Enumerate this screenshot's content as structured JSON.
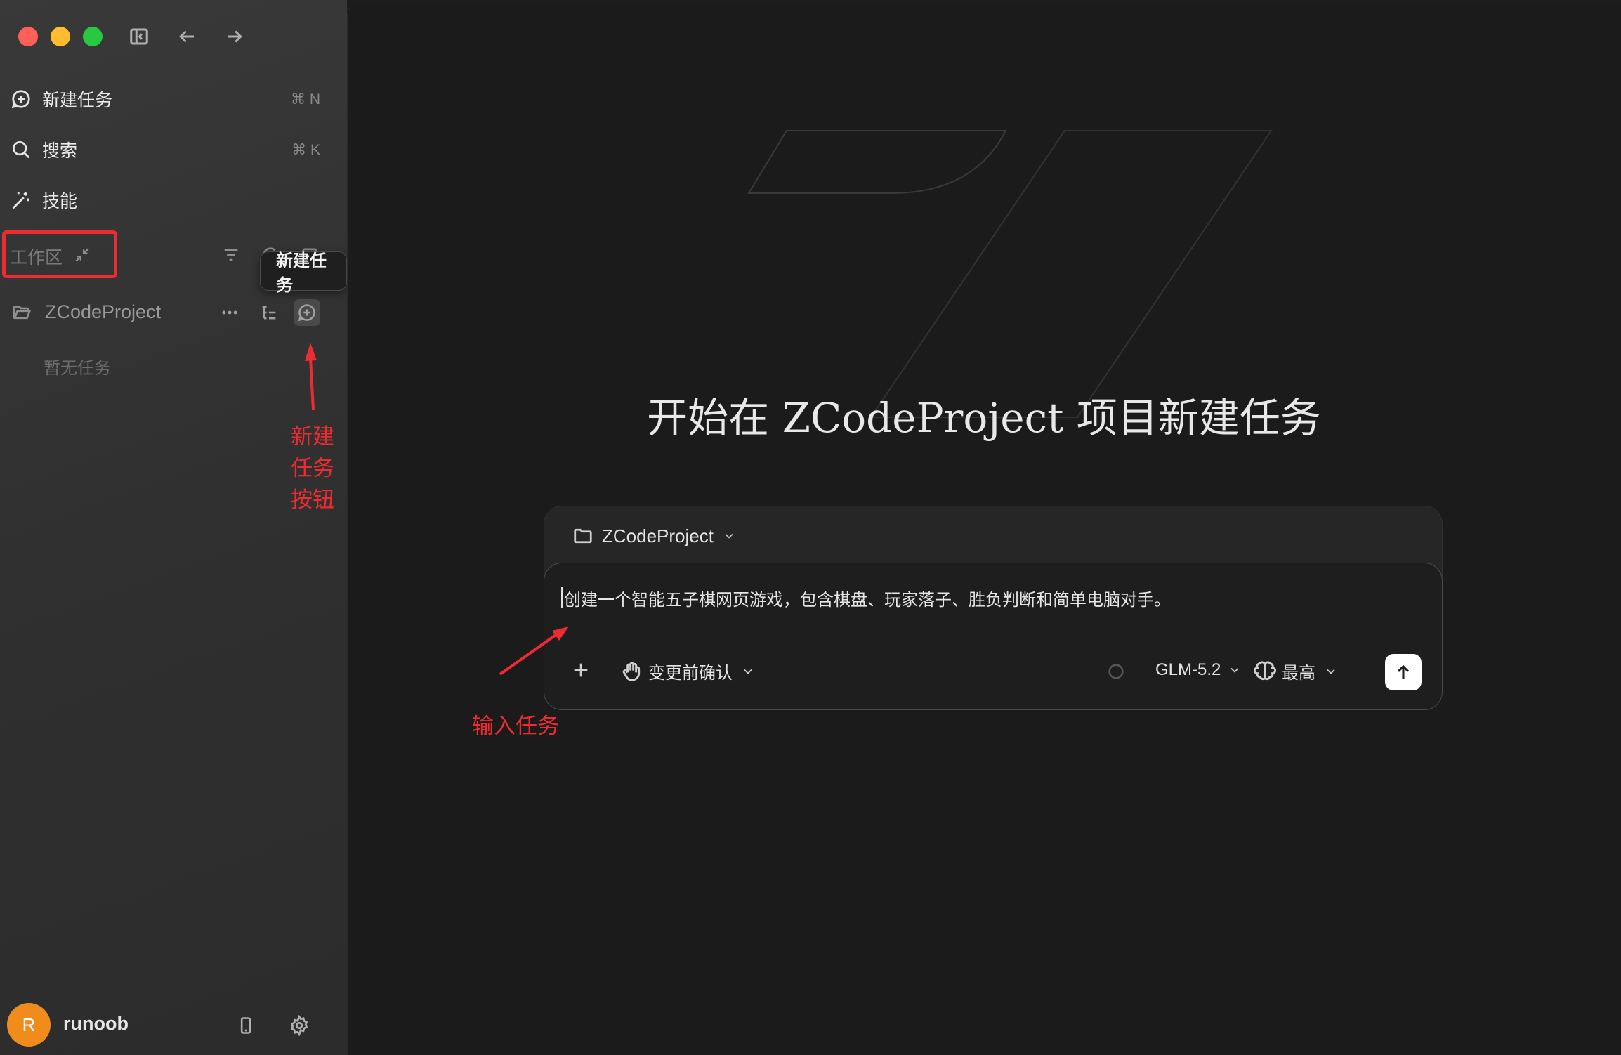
{
  "colors": {
    "annotation_red": "#ed2b32",
    "avatar_orange": "#f08b1c",
    "traffic_close": "#fe5f57",
    "traffic_min": "#febc2e",
    "traffic_max": "#28c840"
  },
  "sidebar": {
    "nav": [
      {
        "label": "新建任务",
        "shortcut": "⌘ N",
        "icon": "new-task-icon"
      },
      {
        "label": "搜索",
        "shortcut": "⌘ K",
        "icon": "search-icon"
      },
      {
        "label": "技能",
        "shortcut": "",
        "icon": "magic-wand-icon"
      }
    ],
    "workspace": {
      "label": "工作区"
    },
    "tooltip": "新建任务",
    "project": {
      "name": "ZCodeProject",
      "empty": "暂无任务"
    },
    "annotation_new_task_button": "新建任务按钮",
    "user": {
      "avatar_letter": "R",
      "name": "runoob"
    }
  },
  "main": {
    "headline": "开始在 ZCodeProject 项目新建任务",
    "composer": {
      "project": "ZCodeProject",
      "prompt": "创建一个智能五子棋网页游戏，包含棋盘、玩家落子、胜负判断和简单电脑对手。",
      "confirm_mode": "变更前确认",
      "model": "GLM-5.2",
      "effort": "最高"
    },
    "annotation_input_task": "输入任务"
  }
}
